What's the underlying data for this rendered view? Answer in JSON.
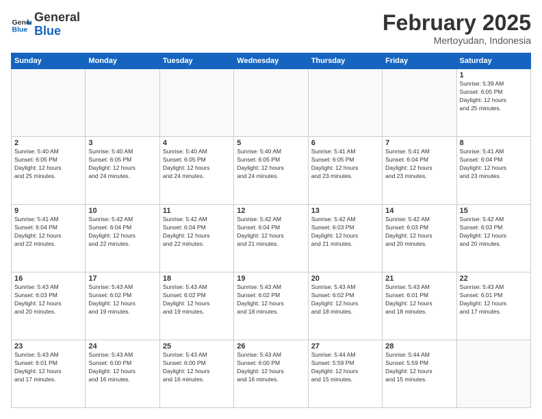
{
  "header": {
    "logo_general": "General",
    "logo_blue": "Blue",
    "month_year": "February 2025",
    "location": "Mertoyudan, Indonesia"
  },
  "weekdays": [
    "Sunday",
    "Monday",
    "Tuesday",
    "Wednesday",
    "Thursday",
    "Friday",
    "Saturday"
  ],
  "weeks": [
    [
      {
        "day": "",
        "info": ""
      },
      {
        "day": "",
        "info": ""
      },
      {
        "day": "",
        "info": ""
      },
      {
        "day": "",
        "info": ""
      },
      {
        "day": "",
        "info": ""
      },
      {
        "day": "",
        "info": ""
      },
      {
        "day": "1",
        "info": "Sunrise: 5:39 AM\nSunset: 6:05 PM\nDaylight: 12 hours\nand 25 minutes."
      }
    ],
    [
      {
        "day": "2",
        "info": "Sunrise: 5:40 AM\nSunset: 6:05 PM\nDaylight: 12 hours\nand 25 minutes."
      },
      {
        "day": "3",
        "info": "Sunrise: 5:40 AM\nSunset: 6:05 PM\nDaylight: 12 hours\nand 24 minutes."
      },
      {
        "day": "4",
        "info": "Sunrise: 5:40 AM\nSunset: 6:05 PM\nDaylight: 12 hours\nand 24 minutes."
      },
      {
        "day": "5",
        "info": "Sunrise: 5:40 AM\nSunset: 6:05 PM\nDaylight: 12 hours\nand 24 minutes."
      },
      {
        "day": "6",
        "info": "Sunrise: 5:41 AM\nSunset: 6:05 PM\nDaylight: 12 hours\nand 23 minutes."
      },
      {
        "day": "7",
        "info": "Sunrise: 5:41 AM\nSunset: 6:04 PM\nDaylight: 12 hours\nand 23 minutes."
      },
      {
        "day": "8",
        "info": "Sunrise: 5:41 AM\nSunset: 6:04 PM\nDaylight: 12 hours\nand 23 minutes."
      }
    ],
    [
      {
        "day": "9",
        "info": "Sunrise: 5:41 AM\nSunset: 6:04 PM\nDaylight: 12 hours\nand 22 minutes."
      },
      {
        "day": "10",
        "info": "Sunrise: 5:42 AM\nSunset: 6:04 PM\nDaylight: 12 hours\nand 22 minutes."
      },
      {
        "day": "11",
        "info": "Sunrise: 5:42 AM\nSunset: 6:04 PM\nDaylight: 12 hours\nand 22 minutes."
      },
      {
        "day": "12",
        "info": "Sunrise: 5:42 AM\nSunset: 6:04 PM\nDaylight: 12 hours\nand 21 minutes."
      },
      {
        "day": "13",
        "info": "Sunrise: 5:42 AM\nSunset: 6:03 PM\nDaylight: 12 hours\nand 21 minutes."
      },
      {
        "day": "14",
        "info": "Sunrise: 5:42 AM\nSunset: 6:03 PM\nDaylight: 12 hours\nand 20 minutes."
      },
      {
        "day": "15",
        "info": "Sunrise: 5:42 AM\nSunset: 6:03 PM\nDaylight: 12 hours\nand 20 minutes."
      }
    ],
    [
      {
        "day": "16",
        "info": "Sunrise: 5:43 AM\nSunset: 6:03 PM\nDaylight: 12 hours\nand 20 minutes."
      },
      {
        "day": "17",
        "info": "Sunrise: 5:43 AM\nSunset: 6:02 PM\nDaylight: 12 hours\nand 19 minutes."
      },
      {
        "day": "18",
        "info": "Sunrise: 5:43 AM\nSunset: 6:02 PM\nDaylight: 12 hours\nand 19 minutes."
      },
      {
        "day": "19",
        "info": "Sunrise: 5:43 AM\nSunset: 6:02 PM\nDaylight: 12 hours\nand 18 minutes."
      },
      {
        "day": "20",
        "info": "Sunrise: 5:43 AM\nSunset: 6:02 PM\nDaylight: 12 hours\nand 18 minutes."
      },
      {
        "day": "21",
        "info": "Sunrise: 5:43 AM\nSunset: 6:01 PM\nDaylight: 12 hours\nand 18 minutes."
      },
      {
        "day": "22",
        "info": "Sunrise: 5:43 AM\nSunset: 6:01 PM\nDaylight: 12 hours\nand 17 minutes."
      }
    ],
    [
      {
        "day": "23",
        "info": "Sunrise: 5:43 AM\nSunset: 6:01 PM\nDaylight: 12 hours\nand 17 minutes."
      },
      {
        "day": "24",
        "info": "Sunrise: 5:43 AM\nSunset: 6:00 PM\nDaylight: 12 hours\nand 16 minutes."
      },
      {
        "day": "25",
        "info": "Sunrise: 5:43 AM\nSunset: 6:00 PM\nDaylight: 12 hours\nand 16 minutes."
      },
      {
        "day": "26",
        "info": "Sunrise: 5:43 AM\nSunset: 6:00 PM\nDaylight: 12 hours\nand 16 minutes."
      },
      {
        "day": "27",
        "info": "Sunrise: 5:44 AM\nSunset: 5:59 PM\nDaylight: 12 hours\nand 15 minutes."
      },
      {
        "day": "28",
        "info": "Sunrise: 5:44 AM\nSunset: 5:59 PM\nDaylight: 12 hours\nand 15 minutes."
      },
      {
        "day": "",
        "info": ""
      }
    ]
  ]
}
